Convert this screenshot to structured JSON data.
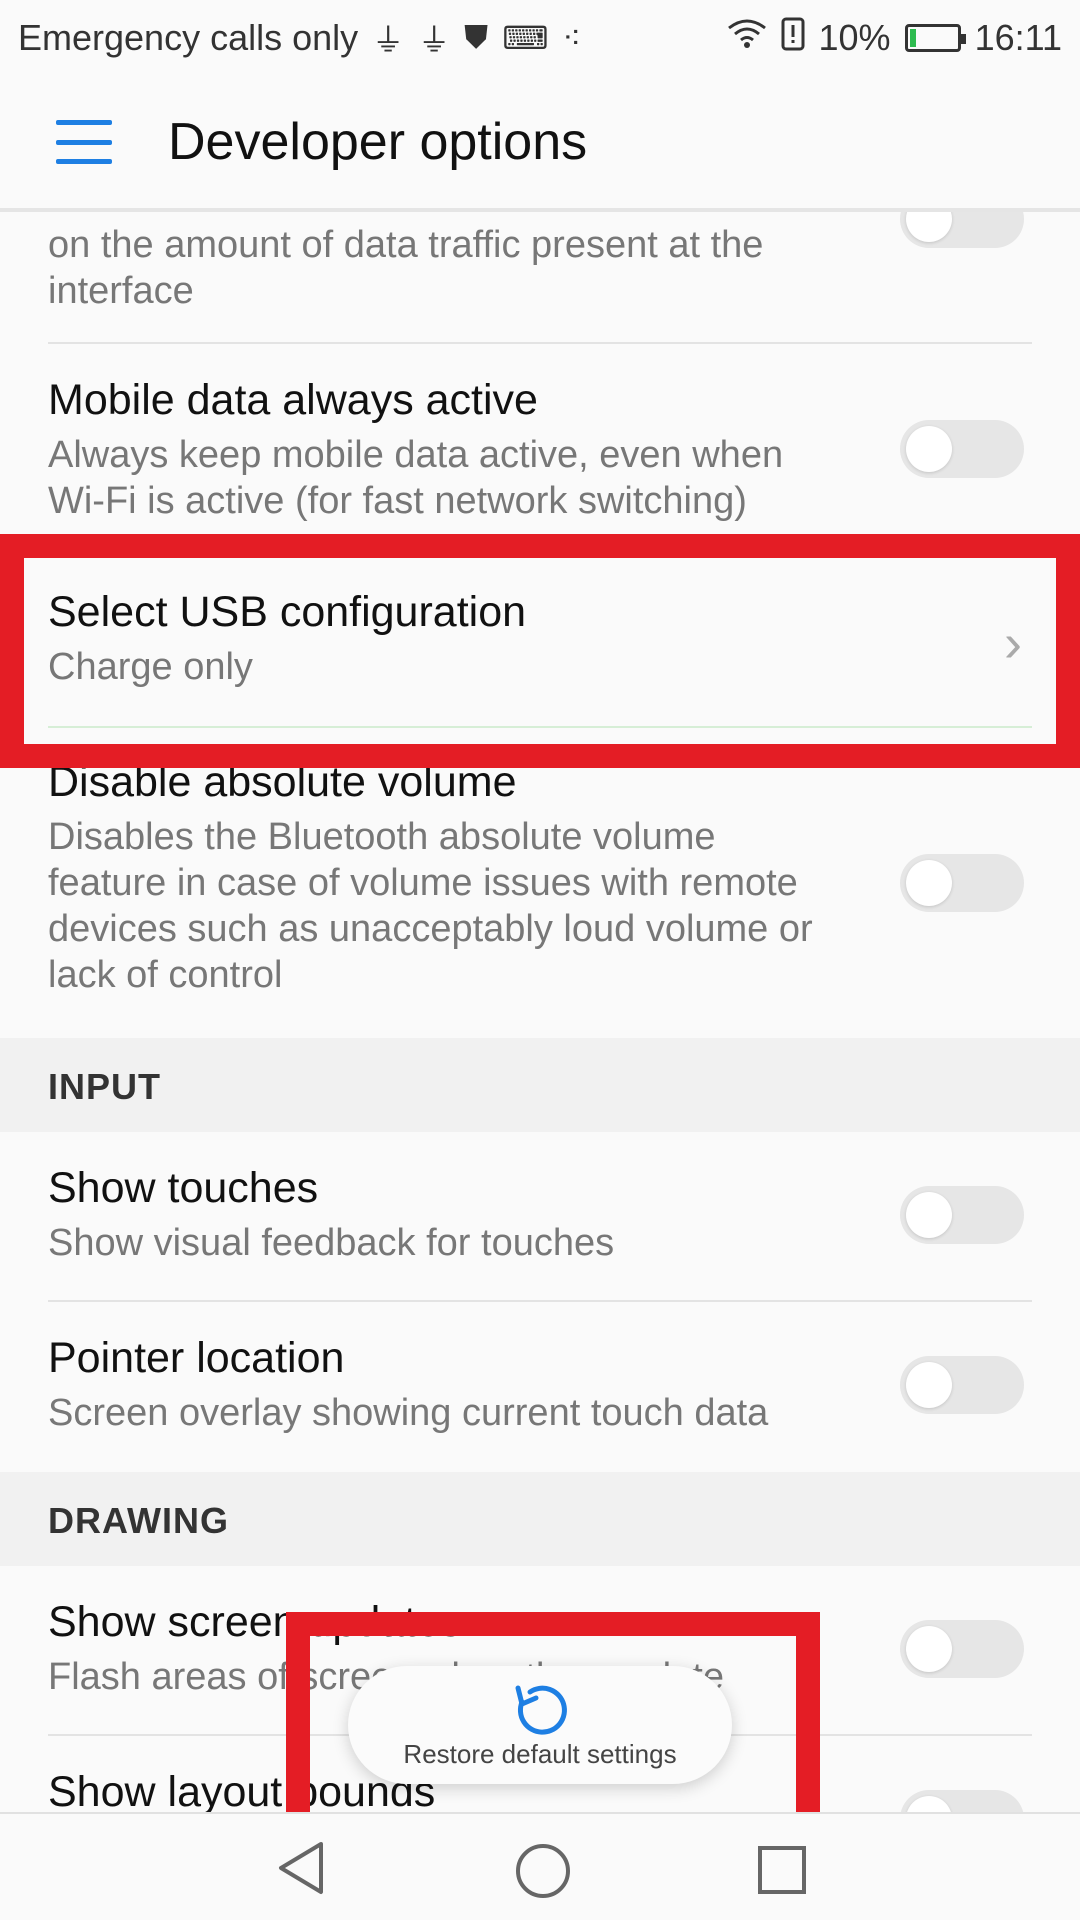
{
  "status_bar": {
    "carrier": "Emergency calls only",
    "battery": "10%",
    "time": "16:11"
  },
  "app_bar": {
    "title": "Developer options"
  },
  "items": {
    "partial_sub_line1": "on the amount of data traffic present at the",
    "partial_sub_line2": "interface",
    "mobile_data": {
      "title": "Mobile data always active",
      "sub1": "Always keep mobile data active, even when",
      "sub2": "Wi-Fi is active (for fast network switching)"
    },
    "usb_config": {
      "title": "Select USB configuration",
      "sub": "Charge only"
    },
    "abs_volume": {
      "title": "Disable absolute volume",
      "sub1": "Disables the Bluetooth absolute volume",
      "sub2": "feature in case of volume issues with remote",
      "sub3": "devices such as unacceptably loud volume or",
      "sub4": "lack of control"
    },
    "input_header": "INPUT",
    "show_touches": {
      "title": "Show touches",
      "sub": "Show visual feedback for touches"
    },
    "pointer_location": {
      "title": "Pointer location",
      "sub": "Screen overlay showing current touch data"
    },
    "drawing_header": "DRAWING",
    "screen_updates": {
      "title": "Show screen updates",
      "sub": "Flash areas of screen when they update"
    },
    "layout_bounds": {
      "title": "Show layout bounds"
    }
  },
  "toast": {
    "label": "Restore default settings"
  },
  "colors": {
    "accent": "#1e7fe3",
    "highlight": "#e41d25"
  }
}
